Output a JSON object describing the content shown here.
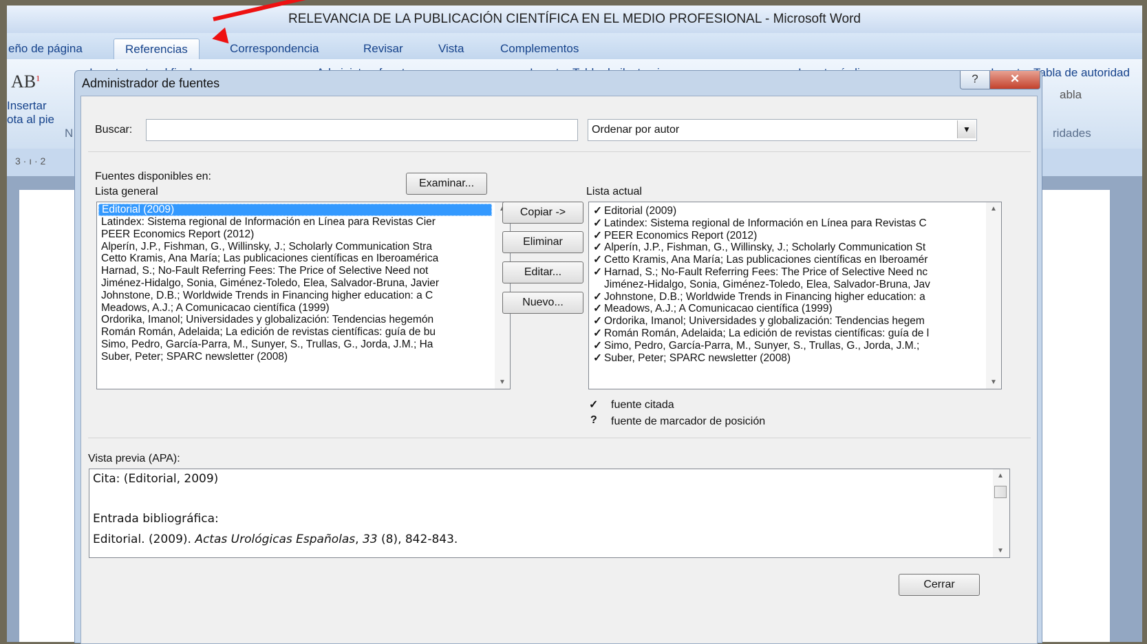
{
  "window": {
    "title": "RELEVANCIA DE LA PUBLICACIÓN CIENTÍFICA EN EL MEDIO PROFESIONAL - Microsoft Word"
  },
  "ribbon": {
    "tabs": [
      "eño de página",
      "Referencias",
      "Correspondencia",
      "Revisar",
      "Vista",
      "Complementos"
    ],
    "active_tab": "Referencias",
    "insert_footnote_line1": "Insertar",
    "insert_footnote_line2": "ota al pie",
    "endnote": "Insertar nota al final",
    "manage_sources": "Administrar fuentes",
    "insert_figures_table": "Insertar Tabla de ilustraciones",
    "insert_index": "Insertar índice",
    "insert_authorities": "Insertar Tabla de autoridad",
    "tabla_fragment": "abla",
    "ridades_fragment": "ridades",
    "footnote_group_fragment": "N",
    "ruler": "3 · ı · 2"
  },
  "dialog": {
    "title": "Administrador de fuentes",
    "help": "?",
    "close": "✕",
    "search_label": "Buscar:",
    "search_value": "",
    "sort_value": "Ordenar por autor",
    "available_in": "Fuentes disponibles en:",
    "general_list_label": "Lista general",
    "browse_button": "Examinar...",
    "current_list_label": "Lista actual",
    "buttons": {
      "copy": "Copiar ->",
      "delete": "Eliminar",
      "edit": "Editar...",
      "new": "Nuevo..."
    },
    "general_list": [
      "Editorial (2009)",
      "Latindex: Sistema regional de Información en Línea para Revistas Cier",
      "PEER Economics Report (2012)",
      "Alperín, J.P., Fishman, G., Willinsky, J.; Scholarly Communication Stra",
      "Cetto Kramis, Ana María; Las publicaciones científicas en Iberoamérica",
      "Harnad, S.; No-Fault Referring Fees: The Price of Selective Need not",
      "Jiménez-Hidalgo, Sonia, Giménez-Toledo, Elea, Salvador-Bruna, Javier",
      "Johnstone, D.B.; Worldwide Trends in Financing higher education: a C",
      "Meadows, A.J.; A Comunicacao científica (1999)",
      "Ordorika, Imanol; Universidades y globalización: Tendencias hegemón",
      "Román Román, Adelaida; La edición de revistas científicas: guía de bu",
      "Simo, Pedro, García-Parra, M., Sunyer, S., Trullas, G., Jorda, J.M.; Ha",
      "Suber, Peter; SPARC newsletter (2008)"
    ],
    "current_list": [
      {
        "text": "Editorial (2009)",
        "check": "✓"
      },
      {
        "text": "Latindex: Sistema regional de Información en Línea para Revistas C",
        "check": "✓"
      },
      {
        "text": "PEER Economics Report (2012)",
        "check": "✓"
      },
      {
        "text": "Alperín, J.P., Fishman, G., Willinsky, J.; Scholarly Communication St",
        "check": "✓"
      },
      {
        "text": "Cetto Kramis, Ana María; Las publicaciones científicas en Iberoamér",
        "check": "✓"
      },
      {
        "text": "Harnad, S.; No-Fault Referring Fees: The Price of Selective Need nc",
        "check": "✓"
      },
      {
        "text": "Jiménez-Hidalgo, Sonia, Giménez-Toledo, Elea, Salvador-Bruna, Jav",
        "check": ""
      },
      {
        "text": "Johnstone, D.B.; Worldwide Trends in Financing higher education: a",
        "check": "✓"
      },
      {
        "text": "Meadows, A.J.; A Comunicacao científica (1999)",
        "check": "✓"
      },
      {
        "text": "Ordorika, Imanol; Universidades y globalización: Tendencias hegem",
        "check": "✓"
      },
      {
        "text": "Román Román, Adelaida; La edición de revistas científicas: guía de l",
        "check": "✓"
      },
      {
        "text": "Simo, Pedro, García-Parra, M., Sunyer, S., Trullas, G., Jorda, J.M.;",
        "check": "✓"
      },
      {
        "text": "Suber, Peter; SPARC newsletter (2008)",
        "check": "✓"
      }
    ],
    "legend": [
      {
        "symbol": "✓",
        "text": "fuente citada"
      },
      {
        "symbol": "?",
        "text": "fuente de marcador de posición"
      }
    ],
    "preview_label": "Vista previa (APA):",
    "preview": {
      "citation": "Cita:  (Editorial, 2009)",
      "bib_label": "Entrada bibliográfica:",
      "bib_start": "Editorial. (2009). ",
      "bib_journal": "Actas Urológicas Españolas",
      "bib_sep": ", ",
      "bib_volume": "33",
      "bib_end": " (8), 842-843."
    },
    "close_button": "Cerrar"
  }
}
